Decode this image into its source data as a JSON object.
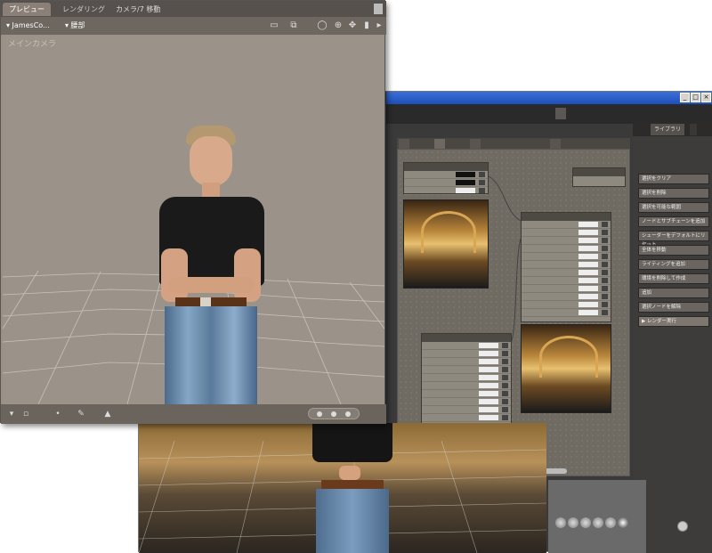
{
  "preview_window": {
    "tabs": {
      "preview": "プレビュー",
      "render": "レンダリング",
      "camera": "カメラ/7 移動"
    },
    "toolbar": {
      "figure_select": "▾ JamesCo...",
      "actor_select": "▾ 腰部"
    },
    "camera_label": "メインカメラ"
  },
  "material_room": {
    "panel_tabs": [
      "ライブラリ"
    ],
    "panel_buttons": [
      "選択をクリア",
      "選択を削除",
      "選択を可能な範囲",
      "ノードとサブチェーンを追加",
      "シェーダーをデフォルトにリセット",
      "全体を移動",
      "ライティングを追加",
      "環境を削除して作成",
      "追加",
      "選択ノードを解除",
      "▶ レンダー実行"
    ]
  },
  "colors": {
    "titlebar": "#1f4fb8",
    "preview_bg": "#9b9389",
    "panel_bg": "#3e3c3a"
  }
}
